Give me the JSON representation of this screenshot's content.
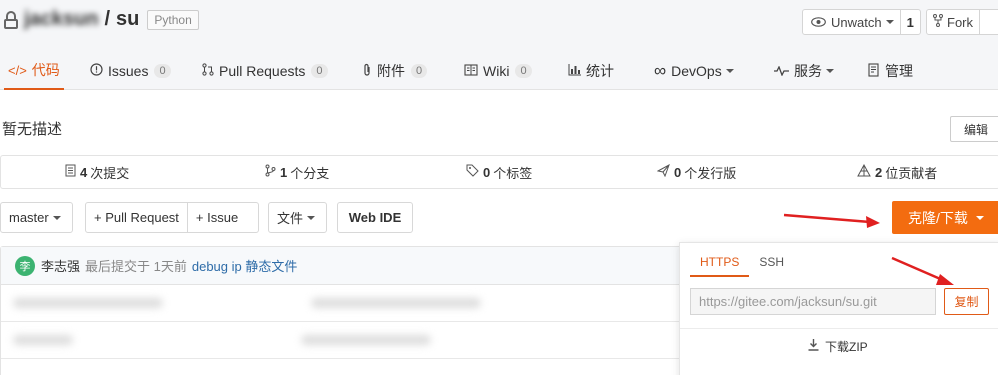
{
  "repo": {
    "owner": "jacksun",
    "separator": "/",
    "name": "su",
    "language_badge": "Python"
  },
  "watch": {
    "label": "Unwatch",
    "count": "1"
  },
  "fork": {
    "label": "Fork"
  },
  "tabs": [
    {
      "label": "代码",
      "icon": "code-icon",
      "active": true
    },
    {
      "label": "Issues",
      "icon": "issue-icon",
      "count": "0"
    },
    {
      "label": "Pull Requests",
      "icon": "pull-request-icon",
      "count": "0"
    },
    {
      "label": "附件",
      "icon": "paperclip-icon",
      "count": "0"
    },
    {
      "label": "Wiki",
      "icon": "book-icon",
      "count": "0"
    },
    {
      "label": "统计",
      "icon": "bar-chart-icon"
    },
    {
      "label": "DevOps",
      "icon": "infinity-icon"
    },
    {
      "label": "服务",
      "icon": "pulse-icon"
    },
    {
      "label": "管理",
      "icon": "settings-doc-icon"
    }
  ],
  "description": "暂无描述",
  "edit_label": "编辑",
  "stats": {
    "commits_count": "4",
    "commits_label": "次提交",
    "branches_count": "1",
    "branches_label": "个分支",
    "tags_count": "0",
    "tags_label": "个标签",
    "releases_count": "0",
    "releases_label": "个发行版",
    "contributors_count": "2",
    "contributors_label": "位贡献者"
  },
  "toolbar": {
    "branch": "master",
    "pull_request": "+ Pull Request",
    "issue": "+ Issue",
    "files": "文件",
    "web_ide": "Web IDE",
    "clone": "克隆/下载"
  },
  "last_commit": {
    "avatar_letter": "李",
    "author": "李志强",
    "meta": "最后提交于 1天前",
    "message": "debug ip 静态文件"
  },
  "clone_popover": {
    "tab_https": "HTTPS",
    "tab_ssh": "SSH",
    "url": "https://gitee.com/jacksun/su.git",
    "copy_label": "复制",
    "download_zip": "下载ZIP"
  },
  "colors": {
    "accent": "#e05a17",
    "clone_button": "#f36c10",
    "annotation_arrow": "#e02020"
  }
}
